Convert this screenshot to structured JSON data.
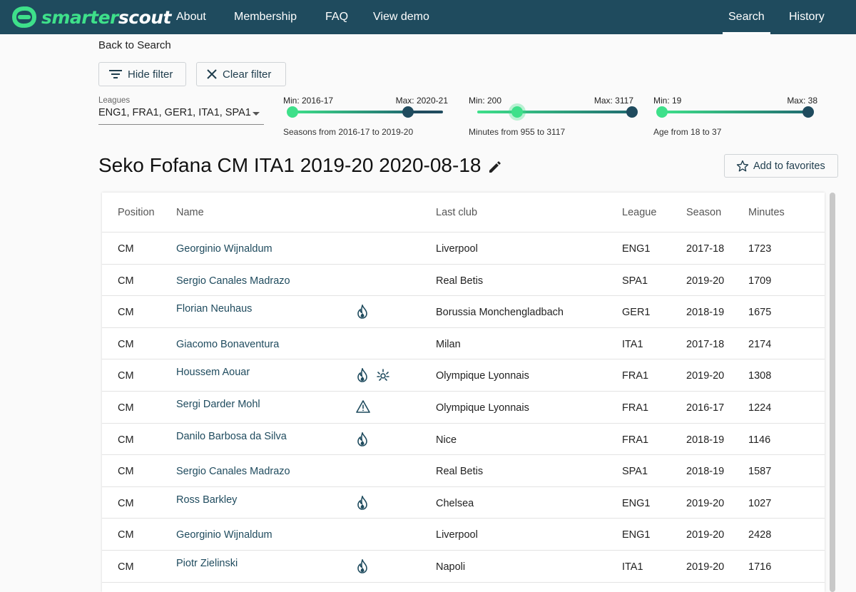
{
  "header": {
    "logo": {
      "part1": "smarter",
      "part2": "scout"
    },
    "nav": [
      {
        "label": "About"
      },
      {
        "label": "Membership"
      },
      {
        "label": "FAQ"
      },
      {
        "label": "View demo"
      }
    ],
    "right_nav": [
      {
        "label": "Search",
        "active": true
      },
      {
        "label": "History",
        "active": false
      }
    ],
    "colors": {
      "bar": "#1f4b5e",
      "accent": "#3ee08a"
    }
  },
  "back_link": "Back to Search",
  "filters": {
    "hide_label": "Hide filter",
    "clear_label": "Clear filter",
    "leagues": {
      "label": "Leagues",
      "value": "ENG1, FRA1, GER1, ITA1, SPA1"
    },
    "seasons": {
      "min_label": "Min: 2016-17",
      "max_label": "Max: 2020-21",
      "caption": "Seasons from 2016-17 to 2019-20",
      "range": [
        "2016-17",
        "2020-21"
      ],
      "selected": [
        "2016-17",
        "2019-20"
      ]
    },
    "minutes": {
      "min_label": "Min: 200",
      "max_label": "Max: 3117",
      "caption": "Minutes from 955 to 3117",
      "range": [
        200,
        3117
      ],
      "selected": [
        955,
        3117
      ]
    },
    "age": {
      "min_label": "Min: 19",
      "max_label": "Max: 38",
      "caption": "Age from 18 to 37",
      "range": [
        19,
        38
      ],
      "selected": [
        19,
        38
      ]
    }
  },
  "player_title": "Seko Fofana CM ITA1 2019-20 2020-08-18",
  "favorites_label": "Add to favorites",
  "table": {
    "columns": [
      "Position",
      "Name",
      "Last club",
      "League",
      "Season",
      "Minutes"
    ],
    "rows": [
      {
        "position": "CM",
        "name": "Georginio Wijnaldum",
        "flags": [],
        "club": "Liverpool",
        "league": "ENG1",
        "season": "2017-18",
        "minutes": "1723"
      },
      {
        "position": "CM",
        "name": "Sergio Canales Madrazo",
        "flags": [],
        "club": "Real Betis",
        "league": "SPA1",
        "season": "2019-20",
        "minutes": "1709"
      },
      {
        "position": "CM",
        "name": "Florian Neuhaus",
        "flags": [
          "flame-icon"
        ],
        "club": "Borussia Monchengladbach",
        "league": "GER1",
        "season": "2018-19",
        "minutes": "1675"
      },
      {
        "position": "CM",
        "name": "Giacomo Bonaventura",
        "flags": [],
        "club": "Milan",
        "league": "ITA1",
        "season": "2017-18",
        "minutes": "2174"
      },
      {
        "position": "CM",
        "name": "Houssem Aouar",
        "flags": [
          "flame-icon",
          "sparkle-icon"
        ],
        "club": "Olympique Lyonnais",
        "league": "FRA1",
        "season": "2019-20",
        "minutes": "1308"
      },
      {
        "position": "CM",
        "name": "Sergi Darder Mohl",
        "flags": [
          "warning-icon"
        ],
        "club": "Olympique Lyonnais",
        "league": "FRA1",
        "season": "2016-17",
        "minutes": "1224"
      },
      {
        "position": "CM",
        "name": "Danilo Barbosa da Silva",
        "flags": [
          "flame-icon"
        ],
        "club": "Nice",
        "league": "FRA1",
        "season": "2018-19",
        "minutes": "1146"
      },
      {
        "position": "CM",
        "name": "Sergio Canales Madrazo",
        "flags": [],
        "club": "Real Betis",
        "league": "SPA1",
        "season": "2018-19",
        "minutes": "1587"
      },
      {
        "position": "CM",
        "name": "Ross Barkley",
        "flags": [
          "flame-icon"
        ],
        "club": "Chelsea",
        "league": "ENG1",
        "season": "2019-20",
        "minutes": "1027"
      },
      {
        "position": "CM",
        "name": "Georginio Wijnaldum",
        "flags": [],
        "club": "Liverpool",
        "league": "ENG1",
        "season": "2019-20",
        "minutes": "2428"
      },
      {
        "position": "CM",
        "name": "Piotr Zielinski",
        "flags": [
          "flame-icon"
        ],
        "club": "Napoli",
        "league": "ITA1",
        "season": "2019-20",
        "minutes": "1716"
      }
    ]
  }
}
